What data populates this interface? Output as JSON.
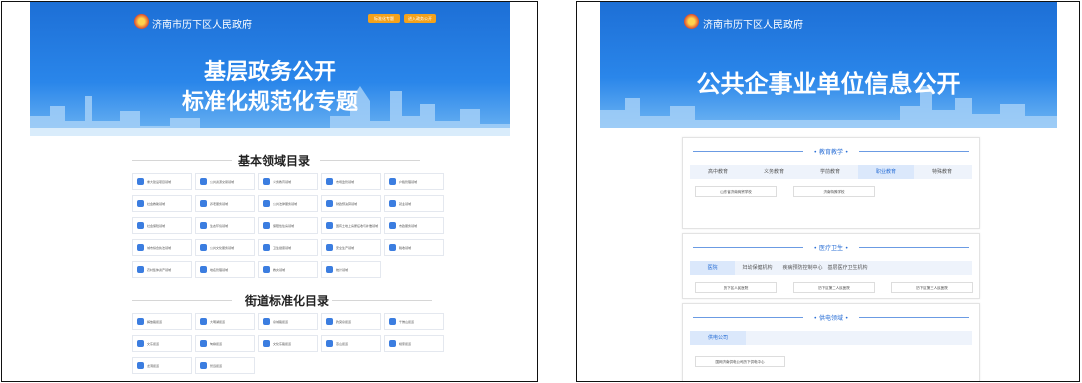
{
  "left": {
    "site_name": "济南市历下区人民政府",
    "header_buttons": [
      "标准化专题",
      "进入政务公开"
    ],
    "banner_title_line1": "基层政务公开",
    "banner_title_line2": "标准化规范化专题",
    "section1_title": "基本领域目录",
    "section2_title": "街道标准化目录",
    "domains": [
      "重大建设项目领域",
      "公共资源交易领域",
      "义务教育领域",
      "市场监管领域",
      "户籍管理领域",
      "社会救助领域",
      "养老服务领域",
      "公共法律服务领域",
      "财政预决算领域",
      "就业领域",
      "社会保险领域",
      "生态环境领域",
      "保障性住房领域",
      "国有土地上房屋征收与补偿领域",
      "市政服务领域",
      "城市综合执法领域",
      "公共文化服务领域",
      "卫生健康领域",
      "安全生产领域",
      "税收领域",
      "农村集体资产领域",
      "地名管理领域",
      "救灾领域",
      "统计领域"
    ],
    "domain_icon_colors": [
      "#3b7de0",
      "#3b7de0",
      "#3b7de0",
      "#3b7de0",
      "#3b7de0",
      "#3b7de0",
      "#3b7de0",
      "#3b7de0",
      "#3b7de0",
      "#3b7de0",
      "#3b7de0",
      "#3b7de0",
      "#3b7de0",
      "#3b7de0",
      "#3b7de0",
      "#3b7de0",
      "#3b7de0",
      "#3b7de0",
      "#3b7de0",
      "#3b7de0",
      "#3b7de0",
      "#3b7de0",
      "#3b7de0",
      "#3b7de0"
    ],
    "streets": [
      "解放路街道",
      "大明湖街道",
      "泉城路街道",
      "趵突泉街道",
      "千佛山街道",
      "文东街道",
      "甸柳街道",
      "文化东路街道",
      "燕山街道",
      "姚家街道",
      "龙洞街道",
      "智远街道"
    ]
  },
  "right": {
    "site_name": "济南市历下区人民政府",
    "banner_title": "公共企事业单位信息公开",
    "cards": [
      {
        "title": "教育教学",
        "tabs": [
          "高中教育",
          "义务教育",
          "学前教育",
          "职业教育",
          "特殊教育"
        ],
        "active": 3,
        "units": [
          "山东省济南商贸学校",
          "济南特殊学校"
        ]
      },
      {
        "title": "医疗卫生",
        "tabs": [
          "医院",
          "妇幼保健机构",
          "疾病预防控制中心",
          "基层医疗卫生机构"
        ],
        "active": 0,
        "units": [
          "历下区人民医院",
          "历下区第二人民医院",
          "历下区第三人民医院"
        ]
      },
      {
        "title": "供电领域",
        "tabs": [
          "供电公司"
        ],
        "active": 0,
        "units": [
          "国网济南供电公司历下供电中心"
        ]
      }
    ]
  }
}
